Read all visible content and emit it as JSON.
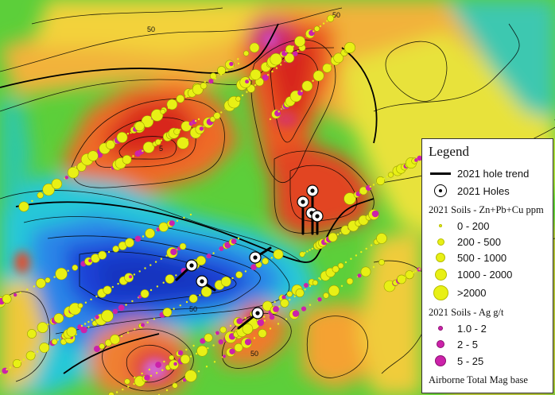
{
  "map": {
    "contour_labels": [
      "50",
      "50",
      "50",
      "50",
      "5"
    ],
    "colors": {
      "background_low": "#1e4fd8",
      "mid_blue": "#20a0e0",
      "cyan": "#28d2d2",
      "green": "#2ebe3a",
      "yellow": "#f0e632",
      "orange": "#f59a2a",
      "red": "#e0321e",
      "high_magenta": "#d050c0",
      "soil_zn": "#e8f015",
      "soil_ag": "#cc22aa"
    }
  },
  "legend": {
    "title": "Legend",
    "hole_trend_label": "2021 hole trend",
    "holes_label": "2021 Holes",
    "zn_heading": "2021 Soils - Zn+Pb+Cu ppm",
    "zn_classes": [
      "0 - 200",
      "200 - 500",
      "500 - 1000",
      "1000 - 2000",
      ">2000"
    ],
    "ag_heading": "2021 Soils - Ag g/t",
    "ag_classes": [
      "1.0 - 2",
      "2 - 5",
      "5 - 25"
    ],
    "base_label": "Airborne Total Mag base"
  }
}
